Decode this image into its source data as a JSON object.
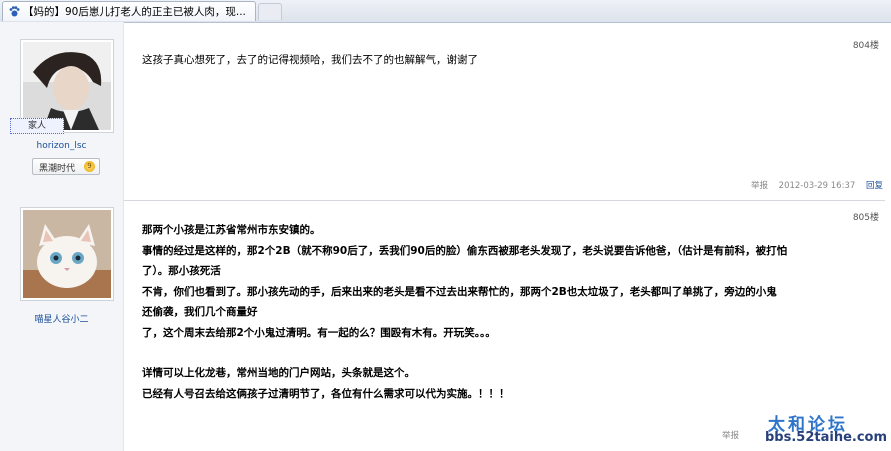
{
  "browser": {
    "tab_title": "【妈的】90后崽儿打老人的正主已被人肉，现..."
  },
  "posts": [
    {
      "floor": "804楼",
      "author": {
        "role": "家人",
        "username": "horizon_lsc",
        "rank": "黑潮时代",
        "rank_icon": "9"
      },
      "content": [
        "这孩子真心想死了，去了的记得视频哈，我们去不了的也解解气，谢谢了"
      ],
      "meta": {
        "report": "举报",
        "time": "2012-03-29 16:37",
        "reply": "回复"
      }
    },
    {
      "floor": "805楼",
      "author": {
        "username": "喵星人谷小二"
      },
      "content": [
        "那两个小孩是江苏省常州市东安镇的。",
        "事情的经过是这样的，那2个2B（就不称90后了，丢我们90后的脸）偷东西被那老头发现了，老头说要告诉他爸，（估计是有前科，被打怕",
        "了）。那小孩死活",
        "不肯，你们也看到了。那小孩先动的手，后来出来的老头是看不过去出来帮忙的，那两个2B也太垃圾了，老头都叫了单挑了，旁边的小鬼",
        "还偷袭，我们几个商量好",
        "了，这个周末去给那2个小鬼过清明。有一起的么？围殴有木有。开玩笑。。。",
        "",
        "详情可以上化龙巷，常州当地的门户网站，头条就是这个。",
        "已经有人号召去给这俩孩子过清明节了，各位有什么需求可以代为实施。！！！"
      ],
      "meta": {
        "report": "举报"
      }
    }
  ],
  "watermark": {
    "title": "太和论坛",
    "url": "bbs.52taihe.com"
  }
}
